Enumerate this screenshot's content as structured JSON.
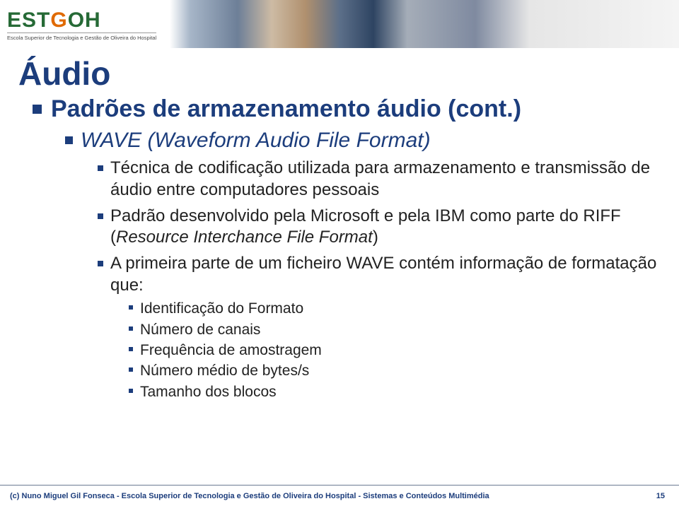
{
  "logo": {
    "main_prefix": "EST",
    "main_g": "G",
    "main_suffix": "OH",
    "sub": "Escola Superior de Tecnologia e Gestão de Oliveira do Hospital"
  },
  "title": "Áudio",
  "bullets": {
    "l1_0": "Padrões de armazenamento áudio (cont.)",
    "l2_0": "WAVE (Waveform Audio File Format)",
    "l3_0": "Técnica de codificação utilizada para armazenamento e transmissão de áudio entre computadores pessoais",
    "l3_1_a": "Padrão desenvolvido pela Microsoft e pela IBM como parte do RIFF (",
    "l3_1_b": "Resource Interchance File Format",
    "l3_1_c": ")",
    "l3_2": "A primeira parte de um ficheiro WAVE contém informação de formatação que:",
    "l4_0": "Identificação do Formato",
    "l4_1": "Número de canais",
    "l4_2": "Frequência de amostragem",
    "l4_3": "Número médio de bytes/s",
    "l4_4": "Tamanho dos blocos"
  },
  "footer": {
    "text": "(c) Nuno Miguel Gil Fonseca  -  Escola Superior de Tecnologia e Gestão de Oliveira do Hospital  -  Sistemas e Conteúdos Multimédia",
    "page": "15"
  }
}
